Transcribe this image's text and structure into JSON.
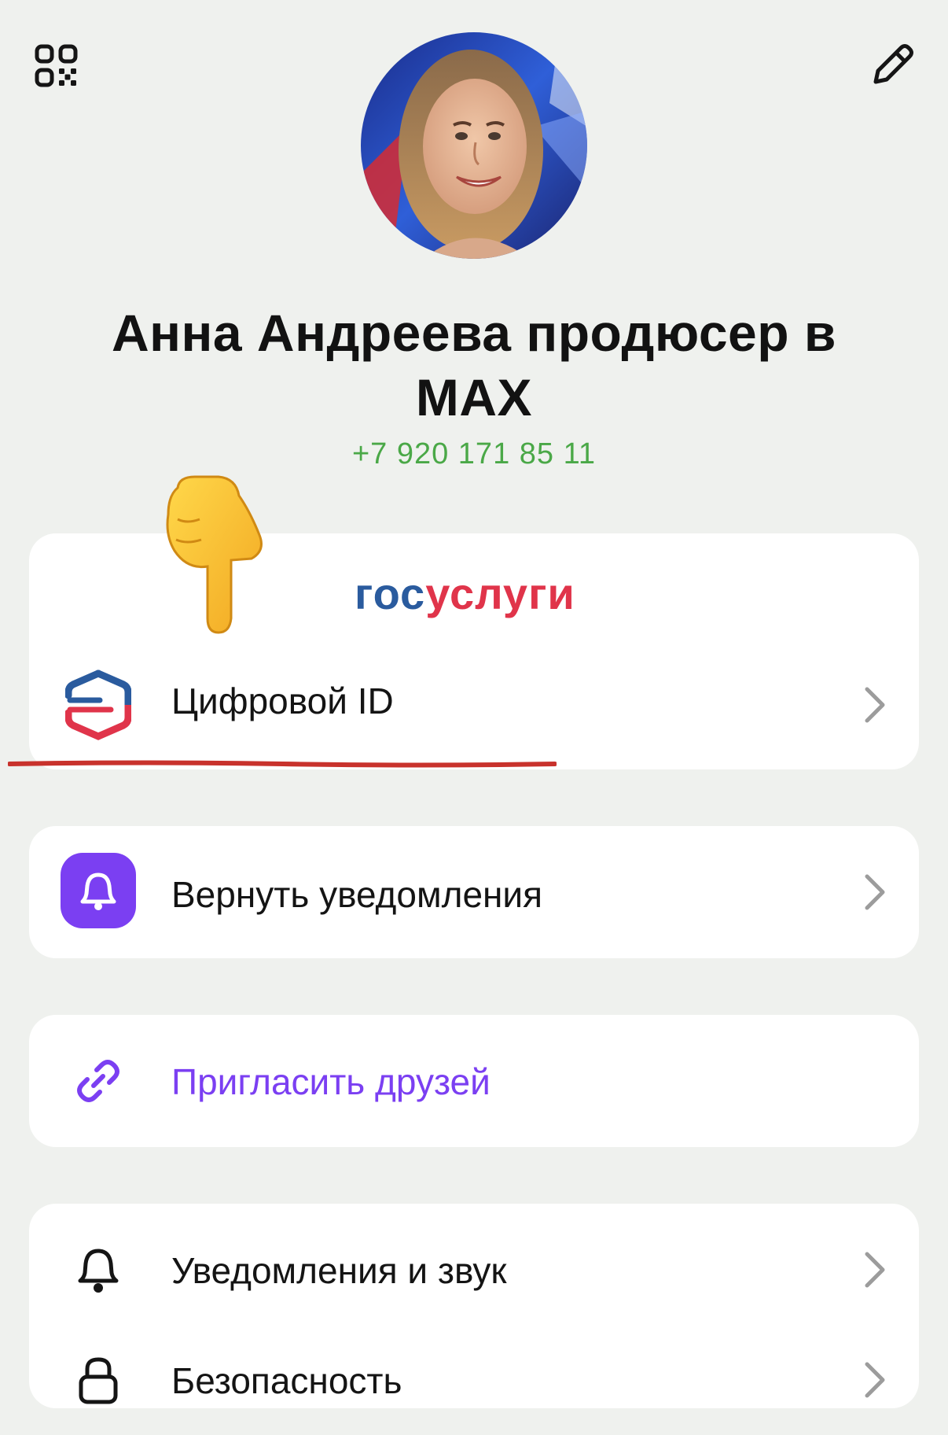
{
  "profile": {
    "name": "Анна Андреева продюсер в MAX",
    "phone": "+7 920 171 85 11"
  },
  "gosuslugi": {
    "logo_part1": "гос",
    "logo_part2": "услуги",
    "digital_id_label": "Цифровой ID"
  },
  "menu": {
    "restore_notifications_label": "Вернуть уведомления",
    "invite_friends_label": "Пригласить друзей",
    "notifications_sound_label": "Уведомления и звук",
    "security_label": "Безопасность"
  },
  "icons": {
    "qr": "qr-code-icon",
    "edit": "pencil-icon",
    "digital_id": "gosuslugi-shield-icon",
    "restore_notifications": "bell-icon",
    "invite": "link-icon",
    "notifications": "bell-outline-icon",
    "security": "lock-icon",
    "chevron": "chevron-right-icon",
    "hand": "pointing-down-hand-icon"
  },
  "colors": {
    "background": "#eff1ee",
    "card": "#ffffff",
    "accent_purple": "#7b3ff2",
    "phone_green": "#4aa847",
    "gos_blue": "#2a5b9e",
    "gos_red": "#e0344a",
    "underline_red": "#c8322c"
  }
}
